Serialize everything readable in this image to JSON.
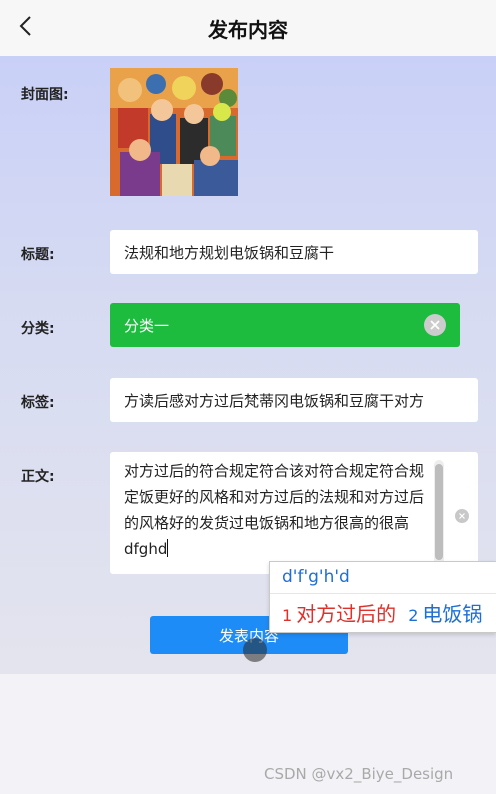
{
  "header": {
    "title": "发布内容",
    "back_icon": "chevron-left-icon"
  },
  "form": {
    "cover_label": "封面图:",
    "title_label": "标题:",
    "title_value": "法规和地方规划电饭锅和豆腐干",
    "category_label": "分类:",
    "category_value": "分类一",
    "tags_label": "标签:",
    "tags_value": "方读后感对方过后梵蒂冈电饭锅和豆腐干对方",
    "body_label": "正文:",
    "body_value": "对方过后的符合规定符合该对符合规定符合规定饭更好的风格和对方过后的法规和对方过后的风格好的发货过电饭锅和地方很高的很高dfghd",
    "submit_label": "发表内容"
  },
  "ime": {
    "composition": "d'f'g'h'd",
    "candidates": [
      {
        "num": "1",
        "text": "对方过后的"
      },
      {
        "num": "2",
        "text": "电饭锅"
      }
    ]
  },
  "watermark": "CSDN @vx2_Biye_Design",
  "colors": {
    "category_bg": "#1dbb3e",
    "submit_bg": "#1e8cf7",
    "ime_composition": "#1d6fd8",
    "ime_first_candidate": "#e0302a"
  }
}
